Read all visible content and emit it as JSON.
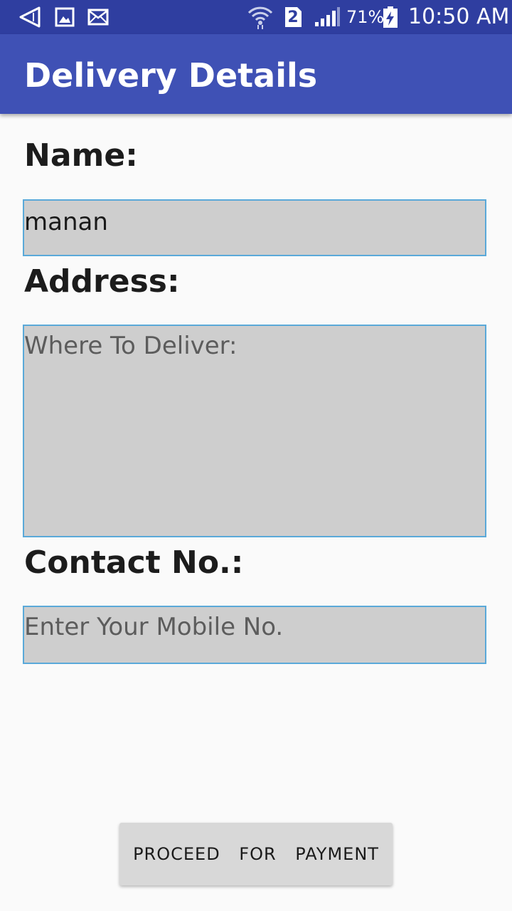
{
  "status_bar": {
    "time": "10:50 AM",
    "battery_percent": "71%",
    "sim_slot": "2",
    "icons": [
      "back-icon",
      "gallery-icon",
      "mail-icon",
      "wifi-icon",
      "sim-icon",
      "signal-icon",
      "battery-charging-icon"
    ]
  },
  "app_bar": {
    "title": "Delivery Details"
  },
  "form": {
    "name_label": "Name:",
    "name_value": "manan",
    "address_label": "Address:",
    "address_placeholder": "Where To Deliver:",
    "contact_label": "Contact No.:",
    "contact_placeholder": "Enter Your Mobile No."
  },
  "actions": {
    "proceed_label": "PROCEED FOR PAYMENT"
  },
  "colors": {
    "status_bar": "#2f3ea0",
    "app_bar": "#3f51b5",
    "field_background": "#cecece",
    "field_border": "#5aa9d9",
    "page_background": "#fafafa",
    "button_background": "#d8d8d8"
  }
}
